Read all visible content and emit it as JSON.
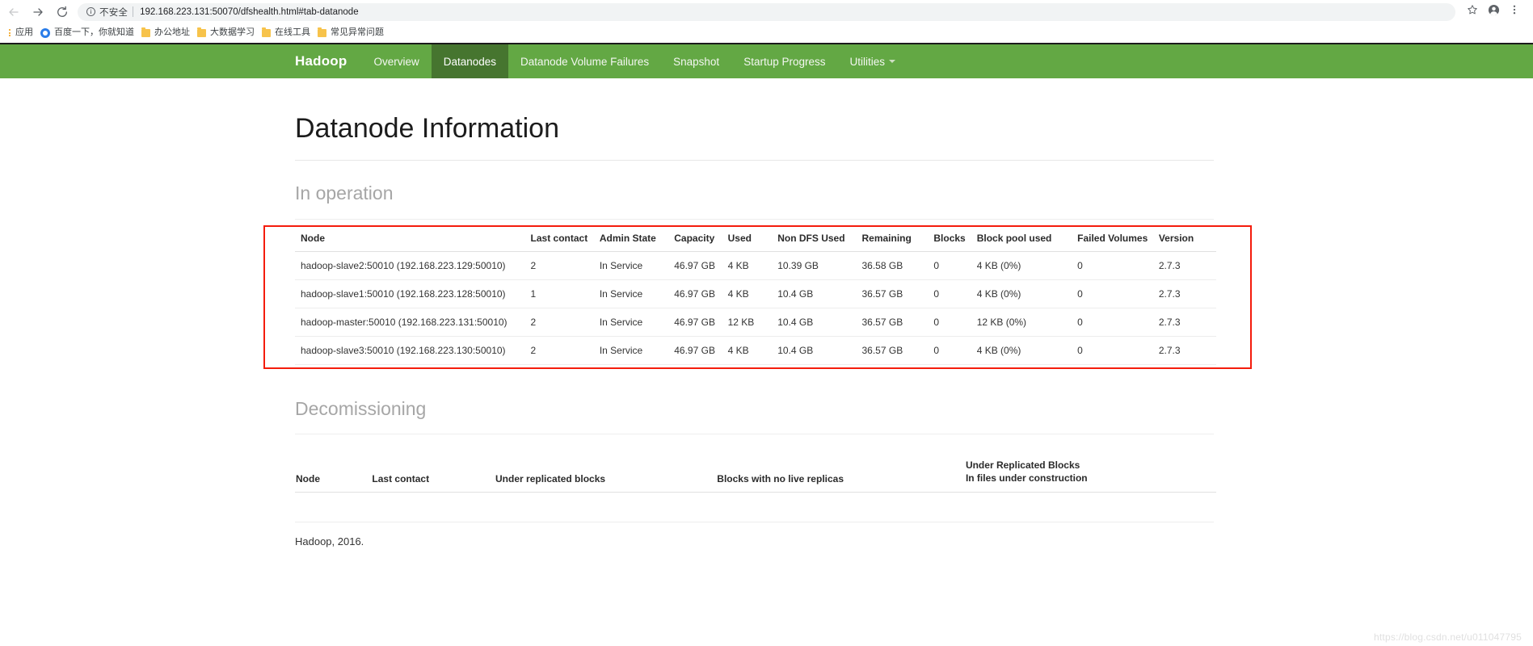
{
  "browser": {
    "back_icon": "back-arrow-icon",
    "forward_icon": "forward-arrow-icon",
    "reload_icon": "reload-icon",
    "info_icon": "info-circle-icon",
    "security_label": "不安全",
    "url": "192.168.223.131:50070/dfshealth.html#tab-datanode",
    "star_icon": "bookmark-star-icon",
    "profile_icon": "profile-avatar-icon",
    "menu_icon": "three-dot-menu-icon",
    "bookmarks": [
      {
        "label": "应用",
        "icon": "apps-grid-icon"
      },
      {
        "label": "百度一下，你就知道",
        "icon": "baidu-favicon"
      },
      {
        "label": "办公地址",
        "icon": "folder-icon"
      },
      {
        "label": "大数据学习",
        "icon": "folder-icon"
      },
      {
        "label": "在线工具",
        "icon": "folder-icon"
      },
      {
        "label": "常见异常问题",
        "icon": "folder-icon"
      }
    ]
  },
  "navbar": {
    "brand": "Hadoop",
    "items": [
      {
        "label": "Overview",
        "active": false
      },
      {
        "label": "Datanodes",
        "active": true
      },
      {
        "label": "Datanode Volume Failures",
        "active": false
      },
      {
        "label": "Snapshot",
        "active": false
      },
      {
        "label": "Startup Progress",
        "active": false
      },
      {
        "label": "Utilities",
        "active": false,
        "caret": true
      }
    ],
    "bg_color": "#63a844",
    "active_bg_color": "#46752f"
  },
  "page": {
    "title": "Datanode Information",
    "in_operation_title": "In operation",
    "decommissioning_title": "Decomissioning",
    "footer": "Hadoop, 2016.",
    "watermark": "https://blog.csdn.net/u011047795",
    "highlight_color": "#f41c0c"
  },
  "in_operation_table": {
    "columns": [
      "Node",
      "Last contact",
      "Admin State",
      "Capacity",
      "Used",
      "Non DFS Used",
      "Remaining",
      "Blocks",
      "Block pool used",
      "Failed Volumes",
      "Version"
    ],
    "rows": [
      {
        "node": "hadoop-slave2:50010 (192.168.223.129:50010)",
        "last_contact": "2",
        "admin_state": "In Service",
        "capacity": "46.97 GB",
        "used": "4 KB",
        "non_dfs_used": "10.39 GB",
        "remaining": "36.58 GB",
        "blocks": "0",
        "block_pool_used": "4 KB (0%)",
        "failed_volumes": "0",
        "version": "2.7.3"
      },
      {
        "node": "hadoop-slave1:50010 (192.168.223.128:50010)",
        "last_contact": "1",
        "admin_state": "In Service",
        "capacity": "46.97 GB",
        "used": "4 KB",
        "non_dfs_used": "10.4 GB",
        "remaining": "36.57 GB",
        "blocks": "0",
        "block_pool_used": "4 KB (0%)",
        "failed_volumes": "0",
        "version": "2.7.3"
      },
      {
        "node": "hadoop-master:50010 (192.168.223.131:50010)",
        "last_contact": "2",
        "admin_state": "In Service",
        "capacity": "46.97 GB",
        "used": "12 KB",
        "non_dfs_used": "10.4 GB",
        "remaining": "36.57 GB",
        "blocks": "0",
        "block_pool_used": "12 KB (0%)",
        "failed_volumes": "0",
        "version": "2.7.3"
      },
      {
        "node": "hadoop-slave3:50010 (192.168.223.130:50010)",
        "last_contact": "2",
        "admin_state": "In Service",
        "capacity": "46.97 GB",
        "used": "4 KB",
        "non_dfs_used": "10.4 GB",
        "remaining": "36.57 GB",
        "blocks": "0",
        "block_pool_used": "4 KB (0%)",
        "failed_volumes": "0",
        "version": "2.7.3"
      }
    ]
  },
  "decommissioning_table": {
    "columns": [
      "Node",
      "Last contact",
      "Under replicated blocks",
      "Blocks with no live replicas"
    ],
    "urb_line1": "Under Replicated Blocks",
    "urb_line2": "In files under construction",
    "rows": []
  }
}
